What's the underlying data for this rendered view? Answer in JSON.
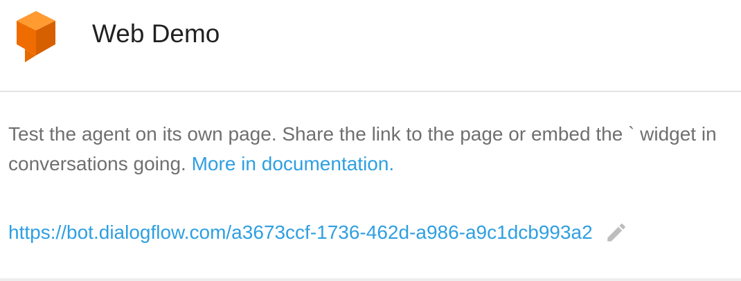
{
  "header": {
    "title": "Web Demo",
    "logo_icon": "dialogflow-logo-icon",
    "logo_colors": {
      "light": "#ff9b31",
      "mid": "#ef6c00",
      "dark": "#d65f00"
    }
  },
  "content": {
    "description_line_1": "Test the agent on its own page. Share the link to the page or embed the ` widget in",
    "description_line_2": "conversations going. ",
    "documentation_link": "More in documentation.",
    "bot_url": "https://bot.dialogflow.com/a3673ccf-1736-462d-a986-a9c1dcb993a2",
    "edit_icon": "pencil-icon"
  },
  "colors": {
    "title": "#212121",
    "description": "#6f6f6f",
    "link": "#2e9fe1",
    "divider": "#e3e3e3",
    "icon": "#bdbdbd"
  }
}
